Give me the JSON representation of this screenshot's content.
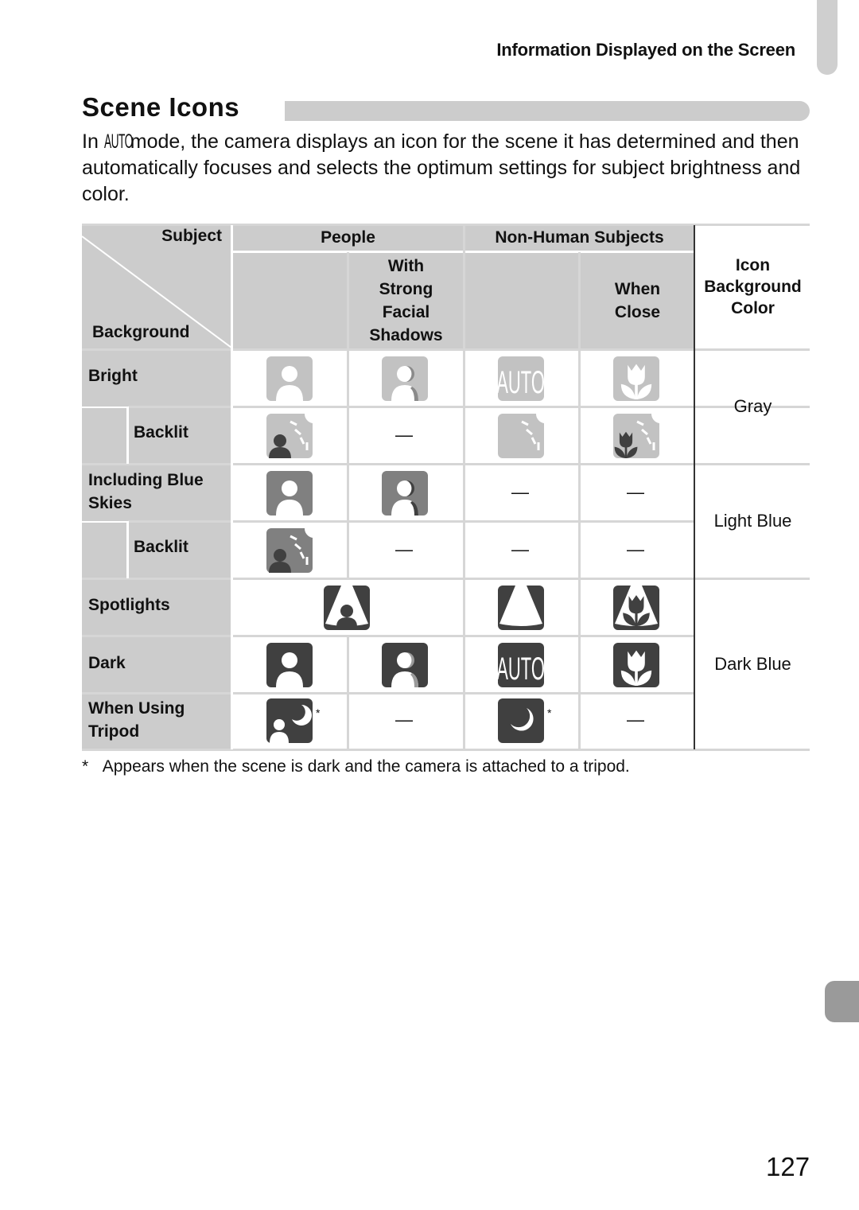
{
  "running_head": "Information Displayed on the Screen",
  "section_title": "Scene Icons",
  "intro": {
    "prefix": "In ",
    "mode_glyph": "AUTO",
    "suffix": " mode, the camera displays an icon for the scene it has determined and then automatically focuses and selects the optimum settings for subject brightness and color."
  },
  "table": {
    "corner": {
      "subject": "Subject",
      "background": "Background"
    },
    "headers": {
      "people": "People",
      "people_shadow": [
        "With",
        "Strong",
        "Facial",
        "Shadows"
      ],
      "non_human": "Non-Human Subjects",
      "non_human_close": [
        "When",
        "Close"
      ],
      "icon_bg": [
        "Icon",
        "Background",
        "Color"
      ]
    },
    "rows": [
      {
        "label": "Bright",
        "cells": [
          "person-icon",
          "person-shadow-icon",
          "auto-icon",
          "macro-flower-icon"
        ]
      },
      {
        "label": "Backlit",
        "cells": [
          "backlit-person-icon",
          "—",
          "backlit-icon",
          "backlit-macro-icon"
        ]
      },
      {
        "label": "Including Blue Skies",
        "cells": [
          "person-icon",
          "person-shadow-icon",
          "—",
          "—"
        ]
      },
      {
        "label": "Backlit",
        "cells": [
          "backlit-person-icon",
          "—",
          "—",
          "—"
        ]
      },
      {
        "label": "Spotlights",
        "cells": [
          "spotlight-person-icon",
          "spotlight-icon",
          "spotlight-macro-icon"
        ]
      },
      {
        "label": "Dark",
        "cells": [
          "person-icon",
          "person-shadow-icon",
          "auto-icon",
          "macro-flower-icon"
        ]
      },
      {
        "label": "When Using Tripod",
        "cells": [
          "night-portrait-icon",
          "—",
          "night-icon",
          "—"
        ]
      }
    ],
    "dash": "—",
    "asterisk": "*",
    "icon_colors": [
      "Gray",
      "Light Blue",
      "Dark Blue"
    ],
    "tone_colors": {
      "gray": "#c2c2c2",
      "light_blue": "#808080",
      "dark_blue": "#404040",
      "header": "#cccccc"
    }
  },
  "footnote": {
    "mark": "*",
    "text": "Appears when the scene is dark and the camera is attached to a tripod."
  },
  "page_number": "127"
}
